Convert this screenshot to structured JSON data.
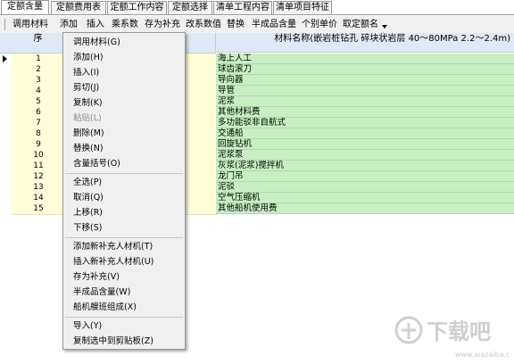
{
  "tabs": [
    {
      "label": "定额含量",
      "active": true
    },
    {
      "label": "定额费用表",
      "active": false
    },
    {
      "label": "定额工作内容",
      "active": false
    },
    {
      "label": "定额选择",
      "active": false
    },
    {
      "label": "清单工程内容",
      "active": false
    },
    {
      "label": "清单项目特征",
      "active": false
    }
  ],
  "toolbar": {
    "buttons": [
      "调用材料",
      "添加",
      "插入",
      "乘系数",
      "存为补充",
      "改系数值",
      "替换",
      "半成品含量",
      "个别单价",
      "取定额名"
    ]
  },
  "grid": {
    "col_seq": "序",
    "col_name": "材料名称(嵌岩桩钻孔 碎块状岩层 40～80MPa 2.2～2.4m)",
    "rows": [
      {
        "num": "1",
        "name": "海上人工"
      },
      {
        "num": "2",
        "name": "球齿滚刀"
      },
      {
        "num": "3",
        "name": "导向器"
      },
      {
        "num": "4",
        "name": "导管"
      },
      {
        "num": "5",
        "name": "泥浆"
      },
      {
        "num": "6",
        "name": "其他材料费"
      },
      {
        "num": "7",
        "name": "多功能驳非自航式"
      },
      {
        "num": "8",
        "name": "交通船"
      },
      {
        "num": "9",
        "name": "回旋钻机"
      },
      {
        "num": "10",
        "name": "泥浆泵"
      },
      {
        "num": "11",
        "name": "灰浆(泥浆)搅拌机"
      },
      {
        "num": "12",
        "name": "龙门吊"
      },
      {
        "num": "13",
        "name": "泥驳"
      },
      {
        "num": "14",
        "name": "空气压缩机"
      },
      {
        "num": "15",
        "name": "其他船机使用费"
      }
    ]
  },
  "context_menu": {
    "items": [
      {
        "label": "调用材料(G)",
        "enabled": true
      },
      {
        "label": "添加(H)",
        "enabled": true
      },
      {
        "label": "插入(I)",
        "enabled": true
      },
      {
        "label": "剪切(J)",
        "enabled": true
      },
      {
        "label": "复制(K)",
        "enabled": true
      },
      {
        "label": "粘贴(L)",
        "enabled": false
      },
      {
        "label": "删除(M)",
        "enabled": true
      },
      {
        "label": "替换(N)",
        "enabled": true
      },
      {
        "label": "含量括号(O)",
        "enabled": true
      },
      {
        "label": "全选(P)",
        "enabled": true
      },
      {
        "label": "取消(Q)",
        "enabled": true
      },
      {
        "label": "上移(R)",
        "enabled": true
      },
      {
        "label": "下移(S)",
        "enabled": true
      },
      {
        "label": "添加新补充人材机(T)",
        "enabled": true
      },
      {
        "label": "插入新补充人材机(U)",
        "enabled": true
      },
      {
        "label": "存为补充(V)",
        "enabled": true
      },
      {
        "label": "半成品含量(W)",
        "enabled": true
      },
      {
        "label": "船机艘班组成(X)",
        "enabled": true
      },
      {
        "label": "导入(Y)",
        "enabled": true
      },
      {
        "label": "复制选中到剪贴板(Z)",
        "enabled": true
      }
    ]
  },
  "watermark": {
    "text": "下载吧",
    "url_text": "www.xiazaiba.com"
  }
}
